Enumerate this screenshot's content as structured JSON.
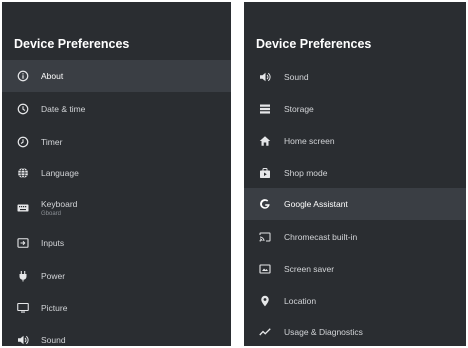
{
  "left_panel": {
    "title": "Device Preferences",
    "items": [
      {
        "label": "About",
        "icon": "info-icon"
      },
      {
        "label": "Date & time",
        "icon": "clock-icon"
      },
      {
        "label": "Timer",
        "icon": "timer-icon"
      },
      {
        "label": "Language",
        "icon": "globe-icon"
      },
      {
        "label": "Keyboard",
        "sublabel": "Gboard",
        "icon": "keyboard-icon"
      },
      {
        "label": "Inputs",
        "icon": "input-icon"
      },
      {
        "label": "Power",
        "icon": "power-plug-icon"
      },
      {
        "label": "Picture",
        "icon": "monitor-icon"
      },
      {
        "label": "Sound",
        "icon": "speaker-icon"
      }
    ],
    "selected_index": 0
  },
  "right_panel": {
    "title": "Device Preferences",
    "items": [
      {
        "label": "Sound",
        "icon": "speaker-icon"
      },
      {
        "label": "Storage",
        "icon": "storage-icon"
      },
      {
        "label": "Home screen",
        "icon": "home-icon"
      },
      {
        "label": "Shop mode",
        "icon": "shop-icon"
      },
      {
        "label": "Google Assistant",
        "icon": "google-g-icon"
      },
      {
        "label": "Chromecast built-in",
        "icon": "cast-icon"
      },
      {
        "label": "Screen saver",
        "icon": "screen-saver-icon"
      },
      {
        "label": "Location",
        "icon": "location-pin-icon"
      },
      {
        "label": "Usage & Diagnostics",
        "icon": "diagnostics-icon"
      }
    ],
    "selected_index": 4
  },
  "colors": {
    "panel_background": "#2a2d31",
    "selected_background": "#3a3e44",
    "text": "#d3d5d8",
    "icon": "#e6e7e9"
  }
}
